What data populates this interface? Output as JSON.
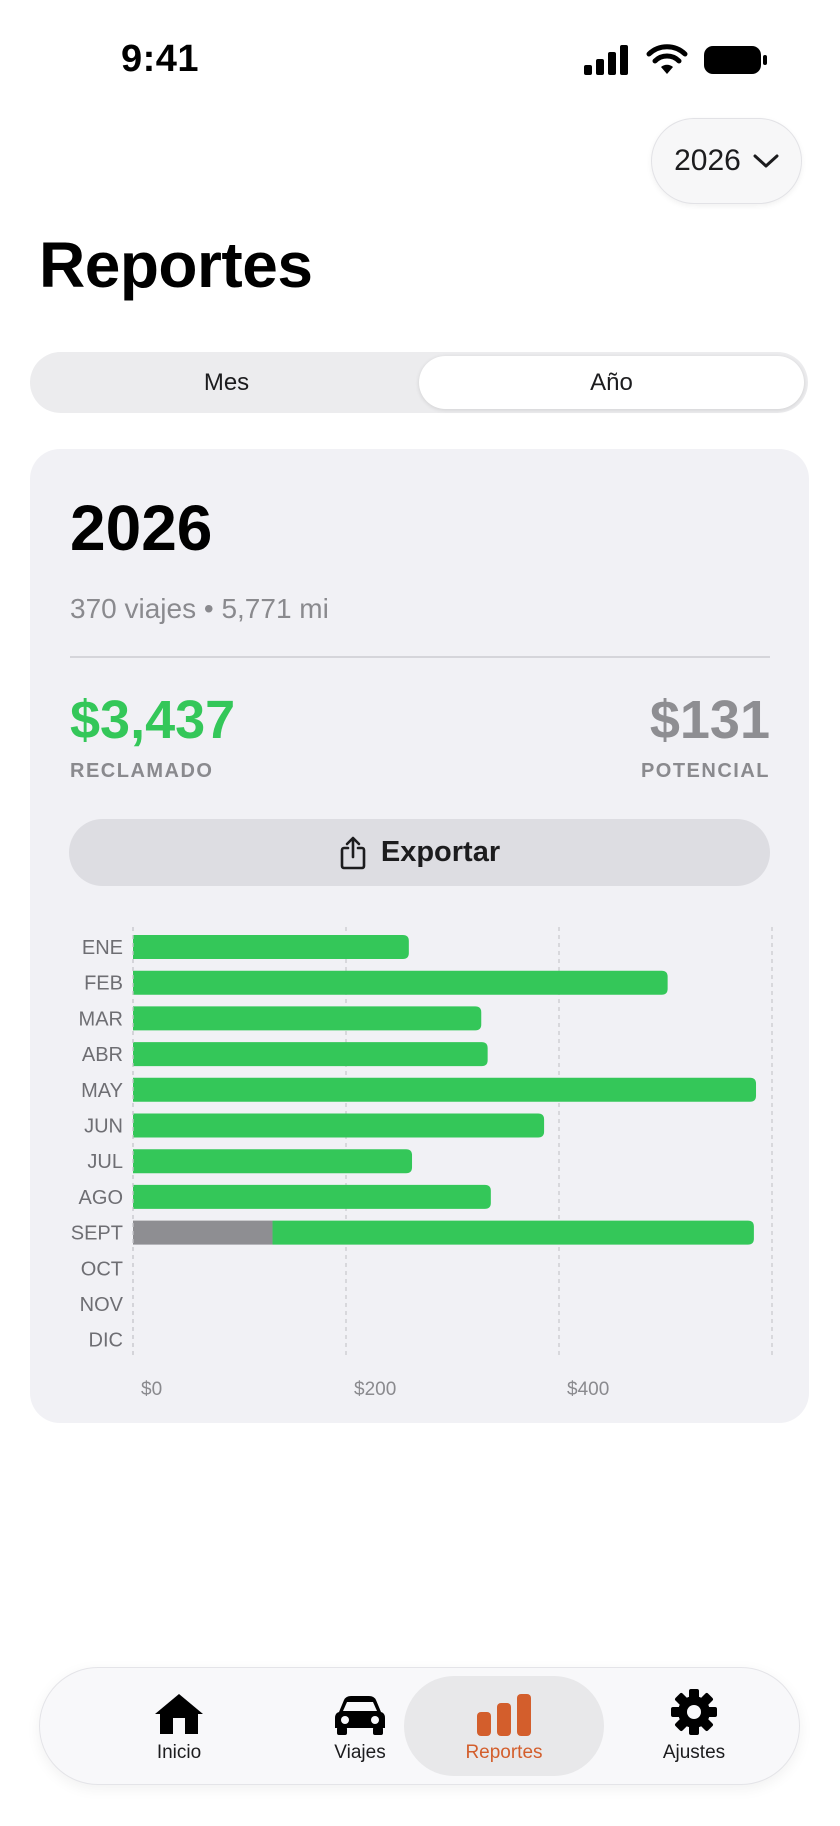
{
  "status": {
    "time": "9:41"
  },
  "year_picker": {
    "label": "2026"
  },
  "title": "Reportes",
  "segments": [
    {
      "label": "Mes",
      "active": false
    },
    {
      "label": "Año",
      "active": true
    }
  ],
  "summary": {
    "year": "2026",
    "subtitle": "370 viajes • 5,771 mi",
    "claimed_amount": "$3,437",
    "claimed_label": "RECLAMADO",
    "potential_amount": "$131",
    "potential_label": "POTENCIAL",
    "export_label": "Exportar"
  },
  "colors": {
    "claimed": "#34c759",
    "potential": "#8e8e92",
    "accent": "#d35e2c"
  },
  "chart_data": {
    "type": "bar",
    "orientation": "horizontal",
    "stacked": true,
    "categories": [
      "ENE",
      "FEB",
      "MAR",
      "ABR",
      "MAY",
      "JUN",
      "JUL",
      "AGO",
      "SEPT",
      "OCT",
      "NOV",
      "DIC"
    ],
    "series": [
      {
        "name": "POTENCIAL",
        "color": "#8e8e92",
        "values": [
          0,
          0,
          0,
          0,
          0,
          0,
          0,
          0,
          131,
          0,
          0,
          0
        ]
      },
      {
        "name": "RECLAMADO",
        "color": "#34c759",
        "values": [
          259,
          502,
          327,
          333,
          585,
          386,
          262,
          336,
          452,
          0,
          0,
          0
        ]
      }
    ],
    "xlim": [
      0,
      600
    ],
    "xticks": [
      0,
      200,
      400,
      600
    ],
    "xtick_labels": [
      "$0",
      "$200",
      "$400"
    ],
    "grid": true
  },
  "tabs": [
    {
      "label": "Inicio",
      "icon": "house-icon",
      "active": false
    },
    {
      "label": "Viajes",
      "icon": "car-icon",
      "active": false
    },
    {
      "label": "Reportes",
      "icon": "bar-chart-icon",
      "active": true
    },
    {
      "label": "Ajustes",
      "icon": "gear-icon",
      "active": false
    }
  ]
}
